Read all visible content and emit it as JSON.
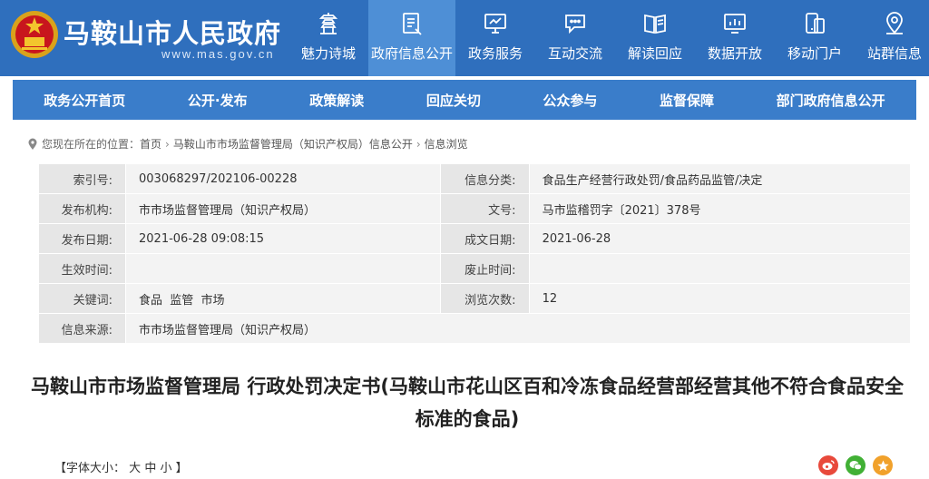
{
  "header": {
    "site_title": "马鞍山市人民政府",
    "site_url": "www.mas.gov.cn",
    "accent_color": "#2f6fbd"
  },
  "topnav": [
    {
      "label": "魅力诗城",
      "icon": "pagoda-icon"
    },
    {
      "label": "政府信息公开",
      "icon": "document-icon",
      "active": true
    },
    {
      "label": "政务服务",
      "icon": "monitor-icon"
    },
    {
      "label": "互动交流",
      "icon": "chat-icon"
    },
    {
      "label": "解读回应",
      "icon": "book-icon"
    },
    {
      "label": "数据开放",
      "icon": "chart-icon"
    },
    {
      "label": "移动门户",
      "icon": "mobile-icon"
    },
    {
      "label": "站群信息",
      "icon": "location-icon"
    }
  ],
  "subnav": [
    "政务公开首页",
    "公开·发布",
    "政策解读",
    "回应关切",
    "公众参与",
    "监督保障",
    "部门政府信息公开"
  ],
  "breadcrumb": {
    "prefix": "您现在所在的位置：",
    "items": [
      "首页",
      "马鞍山市市场监督管理局（知识产权局）信息公开",
      "信息浏览"
    ]
  },
  "meta": {
    "index_label": "索引号:",
    "index_value": "003068297/202106-00228",
    "category_label": "信息分类:",
    "category_value": "食品生产经营行政处罚/食品药品监管/决定",
    "publisher_label": "发布机构:",
    "publisher_value": "市市场监督管理局（知识产权局）",
    "docno_label": "文号:",
    "docno_value": "马市监稽罚字〔2021〕378号",
    "pubdate_label": "发布日期:",
    "pubdate_value": "2021-06-28 09:08:15",
    "created_label": "成文日期:",
    "created_value": "2021-06-28",
    "effective_label": "生效时间:",
    "effective_value": "",
    "expire_label": "废止时间:",
    "expire_value": "",
    "keywords_label": "关键词:",
    "keywords_value": "食品  监管  市场",
    "views_label": "浏览次数:",
    "views_value": "12",
    "source_label": "信息来源:",
    "source_value": "市市场监督管理局（知识产权局）"
  },
  "article": {
    "title": "马鞍山市市场监督管理局 行政处罚决定书(马鞍山市花山区百和冷冻食品经营部经营其他不符合食品安全标准的食品)"
  },
  "fontsize": {
    "prefix": "【字体大小：",
    "large": "大",
    "medium": "中",
    "small": "小",
    "suffix": "】"
  }
}
